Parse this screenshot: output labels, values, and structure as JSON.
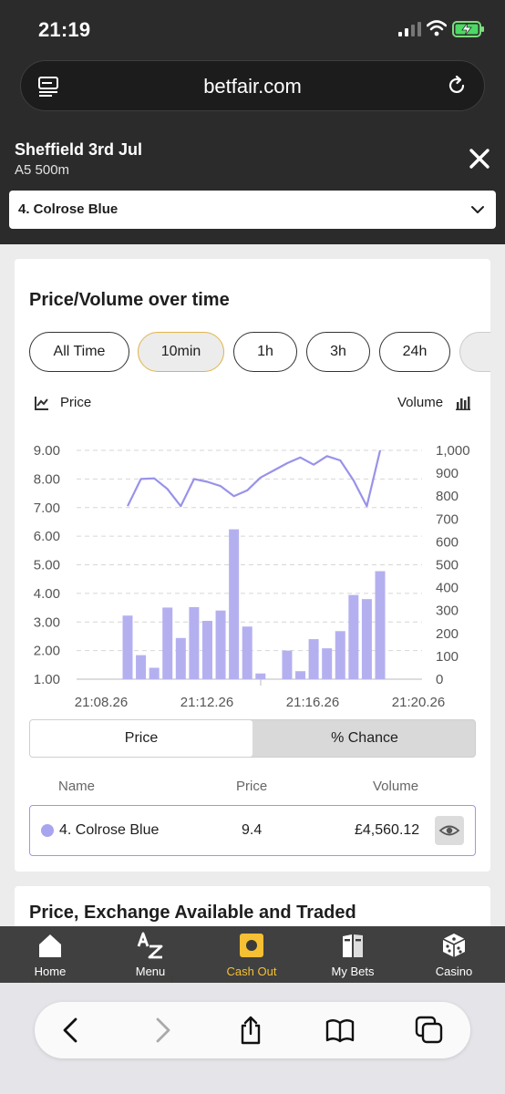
{
  "status_bar": {
    "time": "21:19"
  },
  "browser": {
    "url": "betfair.com"
  },
  "market": {
    "title": "Sheffield 3rd Jul",
    "subtitle": "A5 500m",
    "selected_runner": "4. Colrose Blue"
  },
  "price_volume": {
    "heading": "Price/Volume over time",
    "timeframes": [
      {
        "label": "All Time",
        "active": false
      },
      {
        "label": "10min",
        "active": true
      },
      {
        "label": "1h",
        "active": false
      },
      {
        "label": "3h",
        "active": false
      },
      {
        "label": "24h",
        "active": false
      }
    ],
    "legend_price": "Price",
    "legend_volume": "Volume",
    "toggle": {
      "price_label": "Price",
      "chance_label": "% Chance",
      "selected": "Price"
    },
    "table": {
      "headers": [
        "Name",
        "Price",
        "Volume"
      ],
      "rows": [
        {
          "name": "4. Colrose Blue",
          "price": "9.4",
          "volume": "£4,560.12",
          "color": "#a9a4ef"
        }
      ]
    }
  },
  "chart_data": {
    "type": "bar",
    "x_ticks": [
      "21:08.26",
      "21:12.26",
      "21:16.26",
      "21:20.26"
    ],
    "y_left_ticks": [
      "1.00",
      "2.00",
      "3.00",
      "4.00",
      "5.00",
      "6.00",
      "7.00",
      "8.00",
      "9.00"
    ],
    "y_right_ticks": [
      "0",
      "100",
      "200",
      "300",
      "400",
      "500",
      "600",
      "700",
      "800",
      "900",
      "1,000"
    ],
    "ylim_price": [
      1,
      9
    ],
    "ylim_volume": [
      0,
      1000
    ],
    "volume_bars": [
      278,
      105,
      50,
      313,
      180,
      315,
      255,
      300,
      655,
      230,
      25,
      0,
      125,
      35,
      175,
      135,
      210,
      368,
      350,
      472
    ],
    "price_line": [
      7.05,
      8.0,
      8.02,
      7.65,
      7.05,
      8.0,
      7.9,
      7.75,
      7.4,
      7.6,
      8.05,
      8.3,
      8.55,
      8.75,
      8.5,
      8.8,
      8.65,
      7.95,
      7.05,
      9.0
    ],
    "series_colors": {
      "volume": "#b4b0f0",
      "price": "#9892ea"
    },
    "grid": true
  },
  "next_section": {
    "heading": "Price, Exchange Available and Traded"
  },
  "bottom_nav": [
    {
      "label": "Home",
      "icon": "home-icon",
      "active": false
    },
    {
      "label": "Menu",
      "icon": "az-menu-icon",
      "active": false
    },
    {
      "label": "Cash Out",
      "icon": "cash-out-icon",
      "active": true
    },
    {
      "label": "My Bets",
      "icon": "my-bets-icon",
      "active": false
    },
    {
      "label": "Casino",
      "icon": "dice-icon",
      "active": false
    }
  ],
  "colors": {
    "accent": "#f5c034",
    "chart_purple": "#a9a4ef",
    "header_bg": "#2b2b2b"
  }
}
